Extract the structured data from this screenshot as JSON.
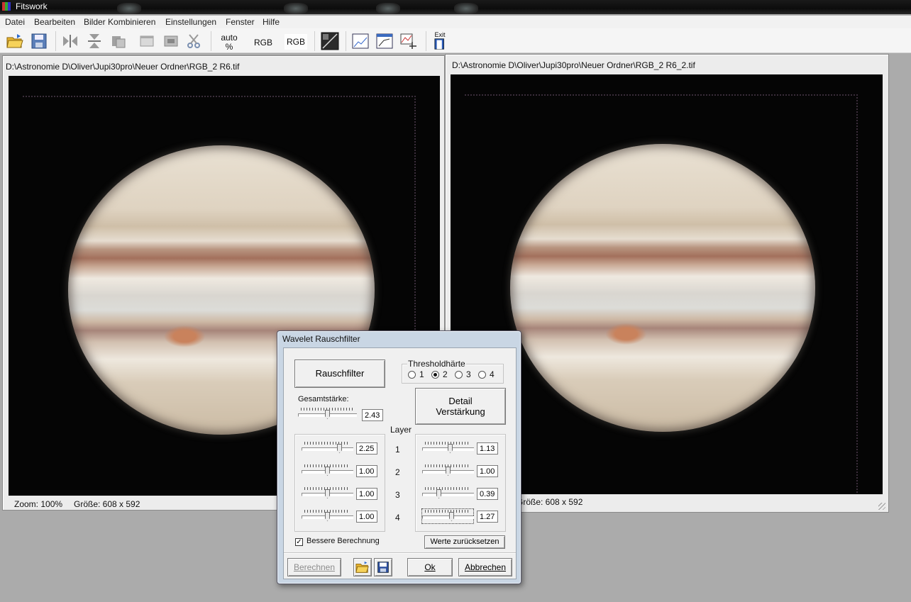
{
  "window": {
    "title": "Fitswork"
  },
  "menu": [
    "Datei",
    "Bearbeiten",
    "Bilder Kombinieren",
    "Einstellungen",
    "Fenster",
    "Hilfe"
  ],
  "toolbar": {
    "auto_label": "auto",
    "percent_label": "%",
    "rgb1_label": "RGB",
    "rgb2_label": "RGB",
    "exit_label": "Exit"
  },
  "left_image": {
    "path": "D:\\Astronomie D\\Oliver\\Jupi30pro\\Neuer Ordner\\RGB_2 R6.tif",
    "zoom": "Zoom: 100%",
    "size": "Größe: 608 x 592"
  },
  "right_image": {
    "path": "D:\\Astronomie D\\Oliver\\Jupi30pro\\Neuer Ordner\\RGB_2 R6_2.tif",
    "size": "Größe: 608 x 592"
  },
  "dialog": {
    "title": "Wavelet Rauschfilter",
    "noise_button": "Rauschfilter",
    "threshold_label": "Thresholdhärte",
    "threshold_options": [
      "1",
      "2",
      "3",
      "4"
    ],
    "threshold_selected": "2",
    "overall_label": "Gesamtstärke:",
    "overall_value": "2.43",
    "detail_button_line1": "Detail",
    "detail_button_line2": "Verstärkung",
    "layer_label": "Layer",
    "layers": [
      {
        "n": "1",
        "noise": "2.25",
        "detail": "1.13"
      },
      {
        "n": "2",
        "noise": "1.00",
        "detail": "1.00"
      },
      {
        "n": "3",
        "noise": "1.00",
        "detail": "0.39"
      },
      {
        "n": "4",
        "noise": "1.00",
        "detail": "1.27"
      }
    ],
    "better_calc_label": "Bessere Berechnung",
    "better_calc_checked": true,
    "reset_button": "Werte zurücksetzen",
    "compute_button": "Berechnen",
    "ok_button": "Ok",
    "cancel_button": "Abbrechen"
  }
}
